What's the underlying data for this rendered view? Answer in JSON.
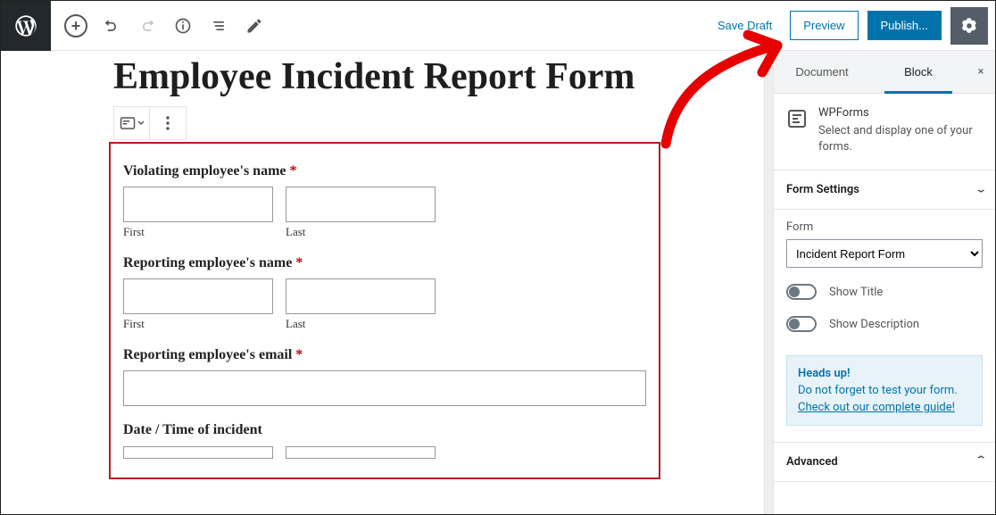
{
  "toolbar": {
    "save_draft": "Save Draft",
    "preview": "Preview",
    "publish": "Publish..."
  },
  "editor": {
    "title": "Employee Incident Report Form",
    "form": {
      "fields": [
        {
          "label": "Violating employee's name",
          "required": true,
          "sub_first": "First",
          "sub_last": "Last"
        },
        {
          "label": "Reporting employee's name",
          "required": true,
          "sub_first": "First",
          "sub_last": "Last"
        },
        {
          "label": "Reporting employee's email",
          "required": true
        },
        {
          "label": "Date / Time of incident",
          "required": false
        }
      ]
    }
  },
  "sidebar": {
    "tabs": {
      "document": "Document",
      "block": "Block"
    },
    "block_name": "WPForms",
    "block_desc": "Select and display one of your forms.",
    "section_form_settings": "Form Settings",
    "form_label": "Form",
    "form_selected": "Incident Report Form",
    "toggle_title": "Show Title",
    "toggle_desc": "Show Description",
    "notice_heads": "Heads up!",
    "notice_msg": "Do not forget to test your form.",
    "notice_link": "Check out our complete guide!",
    "section_advanced": "Advanced"
  }
}
